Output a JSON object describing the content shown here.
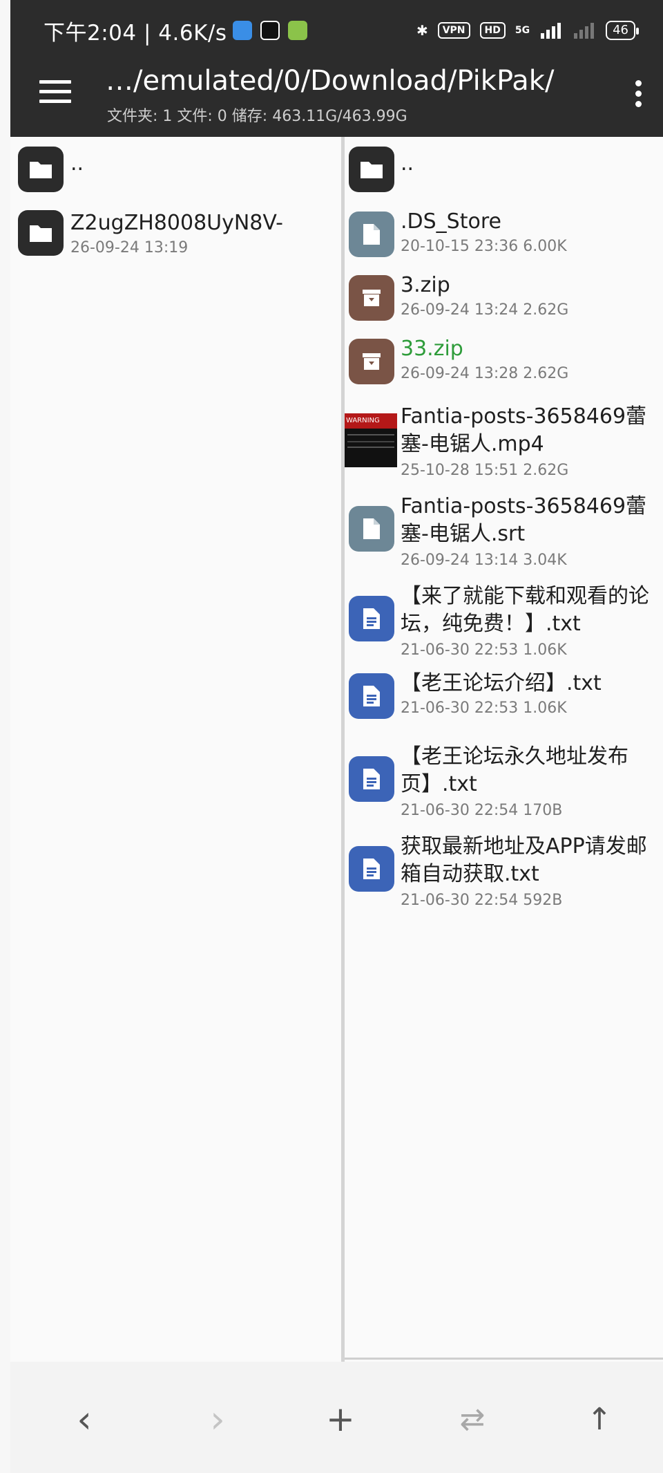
{
  "status_bar": {
    "time": "下午2:04 | 4.6K/s",
    "vpn": "VPN",
    "hd": "HD",
    "network": "5G",
    "battery": "46"
  },
  "app_bar": {
    "path": "…/emulated/0/Download/PikPak/",
    "summary": "文件夹: 1  文件: 0  储存: 463.11G/463.99G"
  },
  "left_pane": {
    "parent": "..",
    "items": [
      {
        "name": "Z2ugZH8008UyN8V-",
        "meta": "26-09-24 13:19"
      }
    ]
  },
  "right_pane": {
    "parent": "..",
    "items": [
      {
        "line1": ".DS_Store",
        "meta": "20-10-15 23:36  6.00K",
        "icon": "file-icon"
      },
      {
        "line1": "3.zip",
        "meta": "26-09-24 13:24  2.62G",
        "icon": "archive-icon"
      },
      {
        "line1": "33.zip",
        "meta": "26-09-24 13:28  2.62G",
        "icon": "archive-icon"
      },
      {
        "line1": "Fantia-posts-3658469蕾",
        "line2": "塞-电锯人.mp4",
        "meta": "25-10-28 15:51  2.62G",
        "icon": "video-thumbnail",
        "thumb_text": "WARNING"
      },
      {
        "line1": "Fantia-posts-3658469蕾",
        "line2": "塞-电锯人.srt",
        "meta": "26-09-24 13:14  3.04K",
        "icon": "file-icon"
      },
      {
        "line1": "【来了就能下载和观看的论",
        "line2": "坛，纯免费！】.txt",
        "meta": "21-06-30 22:53  1.06K",
        "icon": "document-icon"
      },
      {
        "line1": "【老王论坛介绍】.txt",
        "meta": "21-06-30 22:53  1.06K",
        "icon": "document-icon"
      },
      {
        "line1": "【老王论坛永久地址发布",
        "line2": "页】.txt",
        "meta": "21-06-30 22:54  170B",
        "icon": "document-icon"
      },
      {
        "line1": "获取最新地址及APP请发邮",
        "line2": "箱自动获取.txt",
        "meta": "21-06-30 22:54  592B",
        "icon": "document-icon"
      }
    ]
  },
  "bottom_bar": {
    "back": "‹",
    "forward": "›",
    "add": "+",
    "swap": "⇄",
    "up": "↑"
  },
  "colors": {
    "bar_dark": "#2c2c2c",
    "zip_highlight": "#2e9c3a",
    "doc_blue": "#3c64b7",
    "archive_brown": "#7a5446",
    "file_gray": "#6d8796"
  }
}
